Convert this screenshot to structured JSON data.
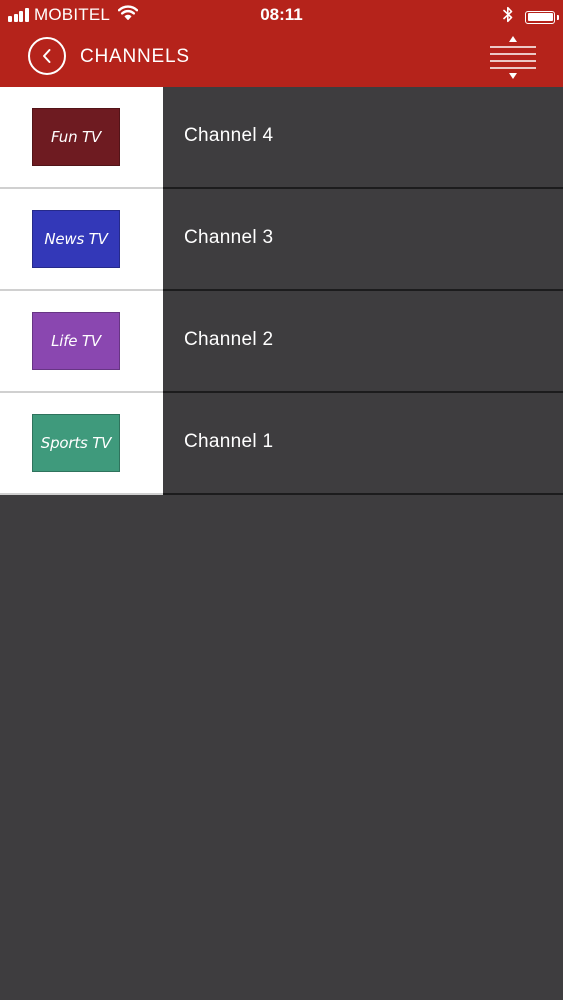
{
  "status_bar": {
    "carrier": "MOBITEL",
    "time": "08:11"
  },
  "header": {
    "title": "CHANNELS"
  },
  "icons": {
    "signal": "signal-bars-icon",
    "wifi": "wifi-icon",
    "bluetooth": "bluetooth-icon",
    "battery": "battery-icon",
    "back": "chevron-left-icon",
    "sort": "sort-icon"
  },
  "colors": {
    "header_bg": "#b5231b",
    "list_bg": "#3e3d3f",
    "fun_tv": "#6e1b21",
    "news_tv": "#3338b8",
    "life_tv": "#8a47b0",
    "sports_tv": "#3f9a7c"
  },
  "channels": [
    {
      "logo_text": "Fun TV",
      "name": "Channel 4",
      "color": "#6e1b21"
    },
    {
      "logo_text": "News TV",
      "name": "Channel 3",
      "color": "#3338b8"
    },
    {
      "logo_text": "Life TV",
      "name": "Channel 2",
      "color": "#8a47b0"
    },
    {
      "logo_text": "Sports TV",
      "name": "Channel 1",
      "color": "#3f9a7c"
    }
  ]
}
